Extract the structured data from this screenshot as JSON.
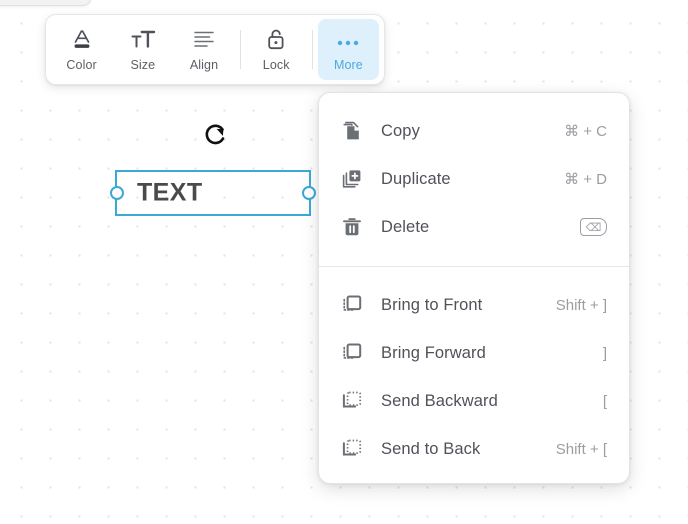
{
  "canvas": {
    "background_color": "#ffffff",
    "dot_color": "#e3e3e6"
  },
  "toolbar": {
    "items": [
      {
        "label": "Color",
        "icon": "text-color-icon",
        "active": false
      },
      {
        "label": "Size",
        "icon": "text-size-icon",
        "active": false
      },
      {
        "label": "Align",
        "icon": "text-align-left-icon",
        "active": false
      },
      {
        "label": "Lock",
        "icon": "unlock-icon",
        "active": false
      },
      {
        "label": "More",
        "icon": "ellipsis-icon",
        "active": true
      }
    ],
    "active_color": "#4ea9dd",
    "active_background": "#ddf0fb"
  },
  "selection": {
    "text": "TEXT",
    "border_color": "#3aa9d8",
    "handle_fill": "#ffffff",
    "rotate_icon": "rotate-icon"
  },
  "context_menu": {
    "groups": [
      {
        "items": [
          {
            "label": "Copy",
            "shortcut": "⌘ + C",
            "icon": "copy-icon",
            "shortcut_type": "text"
          },
          {
            "label": "Duplicate",
            "shortcut": "⌘ + D",
            "icon": "duplicate-icon",
            "shortcut_type": "text"
          },
          {
            "label": "Delete",
            "shortcut": "⌫",
            "icon": "trash-icon",
            "shortcut_type": "key"
          }
        ]
      },
      {
        "items": [
          {
            "label": "Bring to Front",
            "shortcut": "Shift + ]",
            "icon": "bring-to-front-icon",
            "shortcut_type": "text"
          },
          {
            "label": "Bring Forward",
            "shortcut": "]",
            "icon": "bring-forward-icon",
            "shortcut_type": "text"
          },
          {
            "label": "Send Backward",
            "shortcut": "[",
            "icon": "send-backward-icon",
            "shortcut_type": "text"
          },
          {
            "label": "Send to Back",
            "shortcut": "Shift + [",
            "icon": "send-to-back-icon",
            "shortcut_type": "text"
          }
        ]
      }
    ]
  }
}
